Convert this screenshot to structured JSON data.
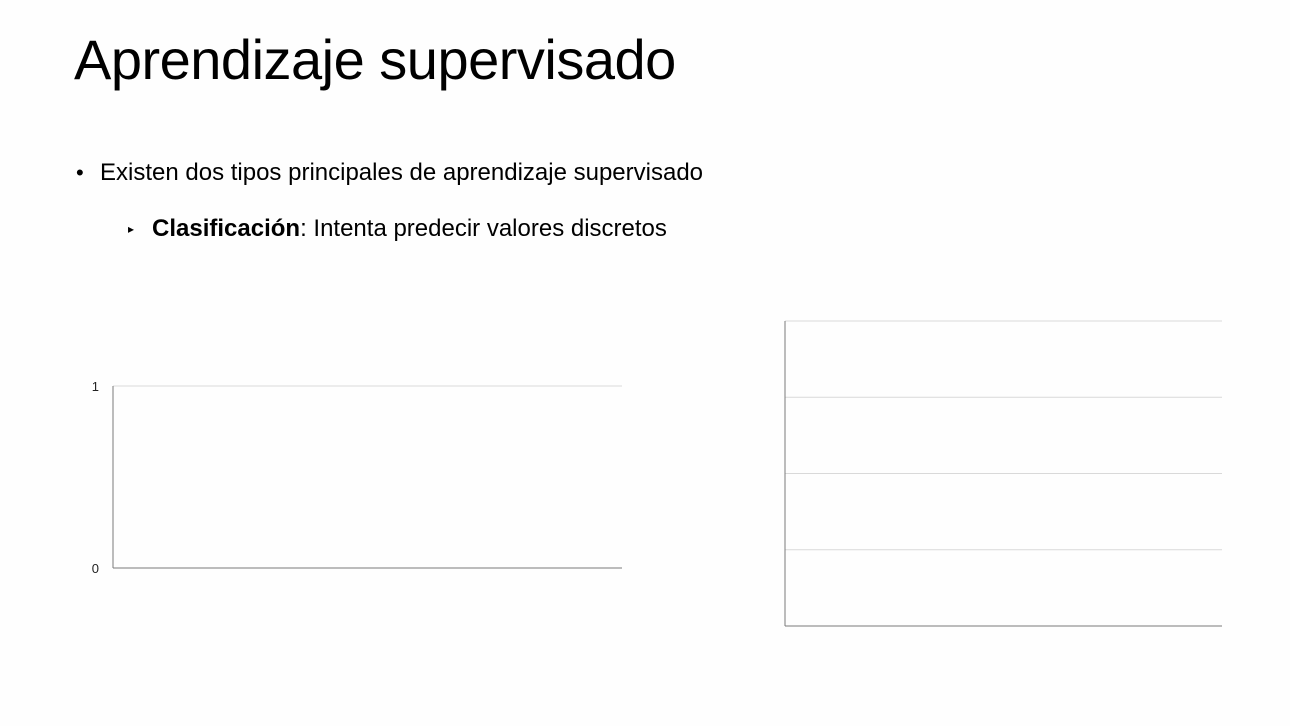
{
  "slide": {
    "title": "Aprendizaje supervisado",
    "bullets": [
      {
        "marker": "•",
        "text": "Existen dos tipos principales de aprendizaje supervisado"
      },
      {
        "marker": "▸",
        "bold": "Clasificación",
        "text": ": Intenta predecir valores discretos"
      }
    ]
  },
  "chart_data": [
    {
      "type": "scatter",
      "series": [],
      "yticks": [
        "0",
        "1"
      ],
      "ylim": [
        0,
        1
      ],
      "title": "",
      "xlabel": "",
      "ylabel": "",
      "grid": true,
      "axis_color": "#7a7a7a",
      "grid_color": "#d9d9d9"
    },
    {
      "type": "scatter",
      "series": [],
      "title": "",
      "xlabel": "",
      "ylabel": "",
      "grid": true,
      "axis_color": "#7a7a7a",
      "grid_color": "#d9d9d9"
    }
  ]
}
